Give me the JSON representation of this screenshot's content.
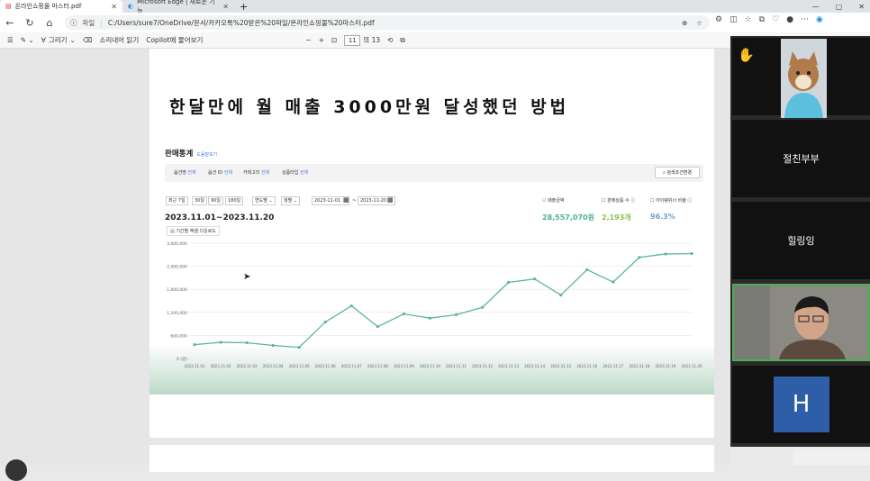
{
  "tabs": [
    {
      "label": "온라인쇼핑몰 마스터.pdf",
      "active": true
    },
    {
      "label": "Microsoft Edge | 새로운 기능",
      "active": false
    }
  ],
  "address": {
    "label": "파일",
    "url": "C:/Users/sure7/OneDrive/문서/카카오톡%20받은%20파일/온라인쇼핑몰%20마스터.pdf"
  },
  "pdf_toolbar": {
    "draw": "그리기",
    "read_aloud": "소리내어 읽기",
    "copilot": "Copilot에 물어보기",
    "page": "11",
    "page_total": "의 13",
    "minus": "−",
    "plus": "+"
  },
  "doc": {
    "headline": "한달만에 월 매출 3000만원 달성했던 방법",
    "section_title": "판매통계",
    "section_sub": "도움말보기",
    "filters": [
      {
        "k": "옵션명",
        "v": "전체"
      },
      {
        "k": "옵션 ID",
        "v": "전체"
      },
      {
        "k": "카테고리",
        "v": "전체"
      },
      {
        "k": "상품타입",
        "v": "전체"
      }
    ],
    "search_btn": "검색조건변경",
    "date_buttons": [
      "최근 7일",
      "30일",
      "90일",
      "180일"
    ],
    "selects": [
      "연도별",
      "월별"
    ],
    "date_from": "2023-11-01",
    "date_to": "2023-11-20",
    "range": "2023.11.01~2023.11.20",
    "download": "기간별 엑셀 다운로드",
    "kpis": [
      {
        "label": "매출금액",
        "value": "28,557,070원",
        "color": "#4db38a"
      },
      {
        "label": "판매상품 수",
        "value": "2,193개",
        "color": "#8bc34a"
      },
      {
        "label": "아이템위너 비율",
        "value": "96.3%",
        "color": "#6fa0d8"
      }
    ]
  },
  "chart_data": {
    "type": "line",
    "categories": [
      "2023.11.01",
      "2023.11.02",
      "2023.11.03",
      "2023.11.04",
      "2023.11.05",
      "2023.11.06",
      "2023.11.07",
      "2023.11.08",
      "2023.11.09",
      "2023.11.10",
      "2023.11.11",
      "2023.11.12",
      "2023.11.13",
      "2023.11.14",
      "2023.11.15",
      "2023.11.16",
      "2023.11.17",
      "2023.11.18",
      "2023.11.19",
      "2023.11.20"
    ],
    "values": [
      360000,
      420000,
      410000,
      340000,
      290000,
      950000,
      1370000,
      830000,
      1160000,
      1050000,
      1140000,
      1330000,
      1980000,
      2070000,
      1650000,
      2310000,
      1990000,
      2630000,
      2720000,
      2730000
    ],
    "yticks": [
      "0 (원)",
      "600,000",
      "1,200,000",
      "1,800,000",
      "2,400,000",
      "3,000,000"
    ],
    "ylim": [
      0,
      3000000
    ],
    "color": "#5cb88f"
  },
  "participants": [
    "절친부부",
    "힐링잉",
    "H"
  ]
}
